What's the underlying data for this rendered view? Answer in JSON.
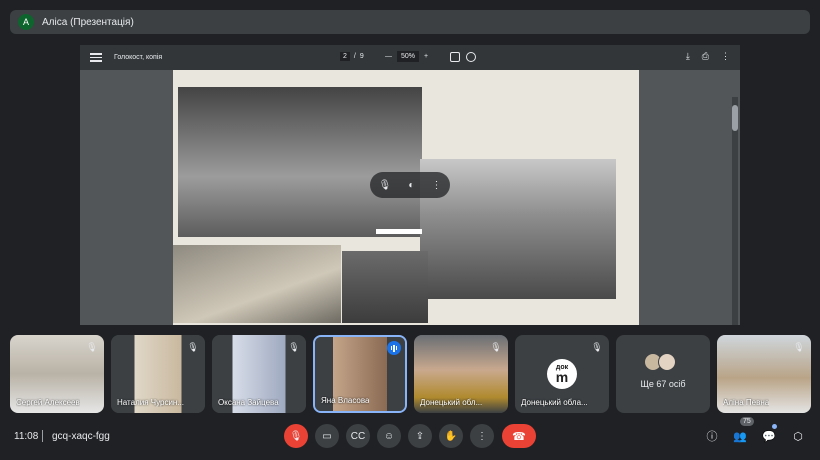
{
  "presenter": {
    "avatar_letter": "A",
    "label": "Аліса (Презентація)"
  },
  "pdf": {
    "title": "Голокост, копія",
    "page_current": "2",
    "page_sep": "/",
    "page_total": "9",
    "zoom_minus": "—",
    "zoom_value": "50%",
    "zoom_plus": "+"
  },
  "tiles": [
    {
      "name": "Сергей Алексеев",
      "muted": true
    },
    {
      "name": "Наталия Чурсин...",
      "muted": true
    },
    {
      "name": "Оксана Зайцева",
      "muted": true
    },
    {
      "name": "Яна Власова",
      "speaking": true
    },
    {
      "name": "Донецький обл...",
      "muted": true
    },
    {
      "name": "Донецький обла...",
      "muted": true,
      "logo_top": "док",
      "logo_main": "m"
    },
    {
      "name": "Ще 67 осіб"
    },
    {
      "name": "Аліна Певна",
      "muted": true
    }
  ],
  "bottom": {
    "time": "11:08",
    "meeting_code": "gcq-xaqc-fgg",
    "participants_count": "75"
  },
  "colors": {
    "accent": "#8ab4f8",
    "danger": "#ea4335",
    "surface": "#3c4043",
    "background": "#202124"
  }
}
